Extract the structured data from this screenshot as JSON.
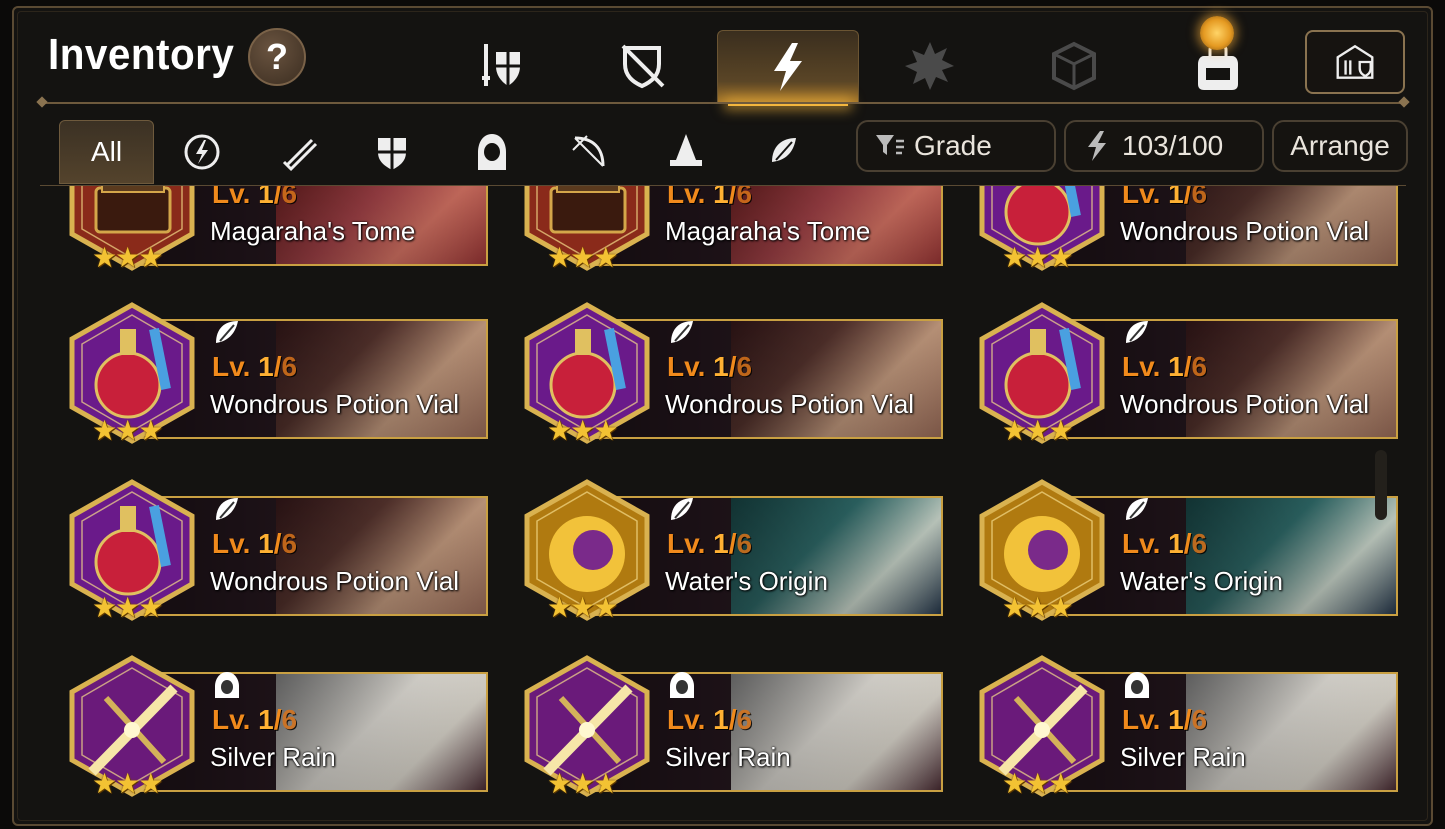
{
  "header": {
    "title": "Inventory",
    "help_label": "?",
    "category_tabs": [
      {
        "icon": "weapon-armor-icon",
        "active": false
      },
      {
        "icon": "shield-disabled-icon",
        "active": false
      },
      {
        "icon": "artifact-lightning-icon",
        "active": true
      },
      {
        "icon": "material-splash-icon",
        "active": false
      },
      {
        "icon": "gem-cube-icon",
        "active": false
      },
      {
        "icon": "backpack-icon",
        "active": false
      }
    ],
    "shop_icon": "armory-shop-icon"
  },
  "filters": {
    "tabs": [
      {
        "label": "All",
        "active": true
      },
      {
        "icon": "all-class-icon"
      },
      {
        "icon": "warrior-class-icon"
      },
      {
        "icon": "knight-class-icon"
      },
      {
        "icon": "thief-class-icon"
      },
      {
        "icon": "ranger-class-icon"
      },
      {
        "icon": "mage-class-icon"
      },
      {
        "icon": "soul-weaver-class-icon"
      }
    ],
    "grade_label": "Grade",
    "capacity_label": "103/100",
    "arrange_label": "Arrange"
  },
  "items": [
    {
      "name": "Magaraha's Tome",
      "level": "1",
      "max": "6",
      "stars": 3,
      "kind": "tome",
      "class": "all"
    },
    {
      "name": "Magaraha's Tome",
      "level": "1",
      "max": "6",
      "stars": 3,
      "kind": "tome",
      "class": "all"
    },
    {
      "name": "Wondrous Potion Vial",
      "level": "1",
      "max": "6",
      "stars": 3,
      "kind": "potion",
      "class": "soul-weaver"
    },
    {
      "name": "Wondrous Potion Vial",
      "level": "1",
      "max": "6",
      "stars": 3,
      "kind": "potion",
      "class": "soul-weaver"
    },
    {
      "name": "Wondrous Potion Vial",
      "level": "1",
      "max": "6",
      "stars": 3,
      "kind": "potion",
      "class": "soul-weaver"
    },
    {
      "name": "Wondrous Potion Vial",
      "level": "1",
      "max": "6",
      "stars": 3,
      "kind": "potion",
      "class": "soul-weaver"
    },
    {
      "name": "Wondrous Potion Vial",
      "level": "1",
      "max": "6",
      "stars": 3,
      "kind": "potion",
      "class": "soul-weaver"
    },
    {
      "name": "Water's Origin",
      "level": "1",
      "max": "6",
      "stars": 3,
      "kind": "ring",
      "class": "soul-weaver"
    },
    {
      "name": "Water's Origin",
      "level": "1",
      "max": "6",
      "stars": 3,
      "kind": "ring",
      "class": "soul-weaver"
    },
    {
      "name": "Silver Rain",
      "level": "1",
      "max": "6",
      "stars": 3,
      "kind": "dagger",
      "class": "thief"
    },
    {
      "name": "Silver Rain",
      "level": "1",
      "max": "6",
      "stars": 3,
      "kind": "dagger",
      "class": "thief"
    },
    {
      "name": "Silver Rain",
      "level": "1",
      "max": "6",
      "stars": 3,
      "kind": "dagger",
      "class": "thief"
    }
  ],
  "level_prefix": "Lv. ",
  "colors": {
    "gold": "#c9a042",
    "level": "#f08a1c",
    "accent": "#f3b63e"
  }
}
